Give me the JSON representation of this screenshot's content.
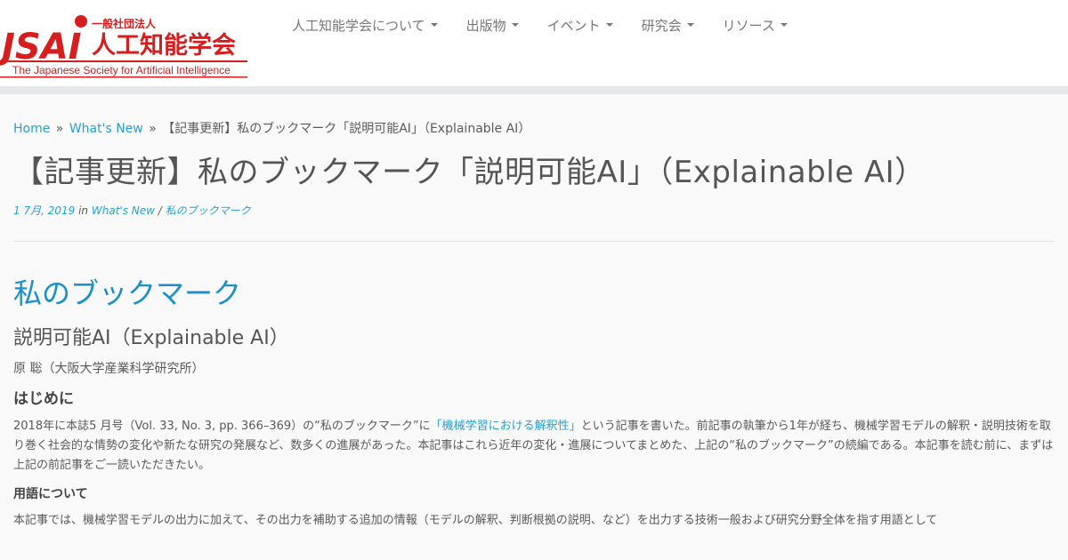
{
  "logo": {
    "mark": "JSAI",
    "org_type": "一般社団法人",
    "name_ja": "人工知能学会",
    "name_en": "The Japanese Society for Artificial Intelligence",
    "brand_red": "#d71e1e"
  },
  "nav": {
    "items": [
      {
        "label": "人工知能学会について"
      },
      {
        "label": "出版物"
      },
      {
        "label": "イベント"
      },
      {
        "label": "研究会"
      },
      {
        "label": "リソース"
      }
    ]
  },
  "breadcrumb": {
    "home": "Home",
    "sep": "»",
    "whats_new": "What's New",
    "current": "【記事更新】私のブックマーク「説明可能AI」（Explainable AI）"
  },
  "post": {
    "title": "【記事更新】私のブックマーク「説明可能AI」（Explainable AI）",
    "date": "1 7月, 2019",
    "in_label": "in",
    "category_1": "What's New",
    "category_sep": "/",
    "category_2": "私のブックマーク"
  },
  "article": {
    "section_title": "私のブックマーク",
    "title": "説明可能AI（Explainable AI）",
    "author": "原 聡（大阪大学産業科学研究所）",
    "intro_heading": "はじめに",
    "intro_text_1": "2018年に本誌5 月号（Vol. 33, No. 3, pp. 366–369）の“私のブックマーク”に",
    "intro_link": "「機械学習における解釈性」",
    "intro_text_2": "という記事を書いた。前記事の執筆から1年が経ち、機械学習モデルの解釈・説明技術を取り巻く社会的な情勢の変化や新たな研究の発展など、数多くの進展があった。本記事はこれら近年の変化・進展についてまとめた、上記の“私のブックマーク”の続編である。本記事を読む前に、まずは上記の前記事をご一読いただきたい。",
    "terms_heading": "用語について",
    "terms_text": "本記事では、機械学習モデルの出力に加えて、その出力を補助する追加の情報（モデルの解釈、判断根拠の説明、など）を出力する技術一般および研究分野全体を指す用語として"
  },
  "colors": {
    "link": "#27a1d5",
    "section_title": "#1a8fcb",
    "band": "#e5e7e9"
  }
}
